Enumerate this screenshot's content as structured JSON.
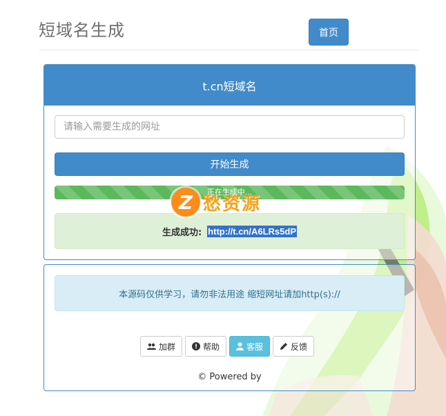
{
  "header": {
    "title": "短域名生成",
    "home_label": "首页"
  },
  "panel": {
    "title": "t.cn短域名",
    "input_placeholder": "请输入需要生成的网址",
    "input_value": "",
    "generate_label": "开始生成",
    "progress_text": "正在生成中...",
    "progress_fraction": 1.0,
    "success_label": "生成成功:",
    "result_url": "http://t.cn/A6LRs5dP"
  },
  "watermark": {
    "text": "愁资源"
  },
  "footer": {
    "notice": "本源码仅供学习，请勿非法用途 缩短网址请加http(s)://",
    "buttons": [
      {
        "label": "加群",
        "icon": "group-icon",
        "active": false
      },
      {
        "label": "帮助",
        "icon": "help-icon",
        "active": false
      },
      {
        "label": "客服",
        "icon": "user-icon",
        "active": true
      },
      {
        "label": "反馈",
        "icon": "pencil-icon",
        "active": false
      }
    ],
    "powered_text": "© Powered by"
  },
  "colors": {
    "primary": "#428bca",
    "success_bar": "#5cb85c",
    "success_bg": "#dff0d8",
    "info_bg": "#d9edf7",
    "info_text": "#31708f",
    "active_button": "#5bc0de",
    "watermark": "#f7a21a"
  }
}
